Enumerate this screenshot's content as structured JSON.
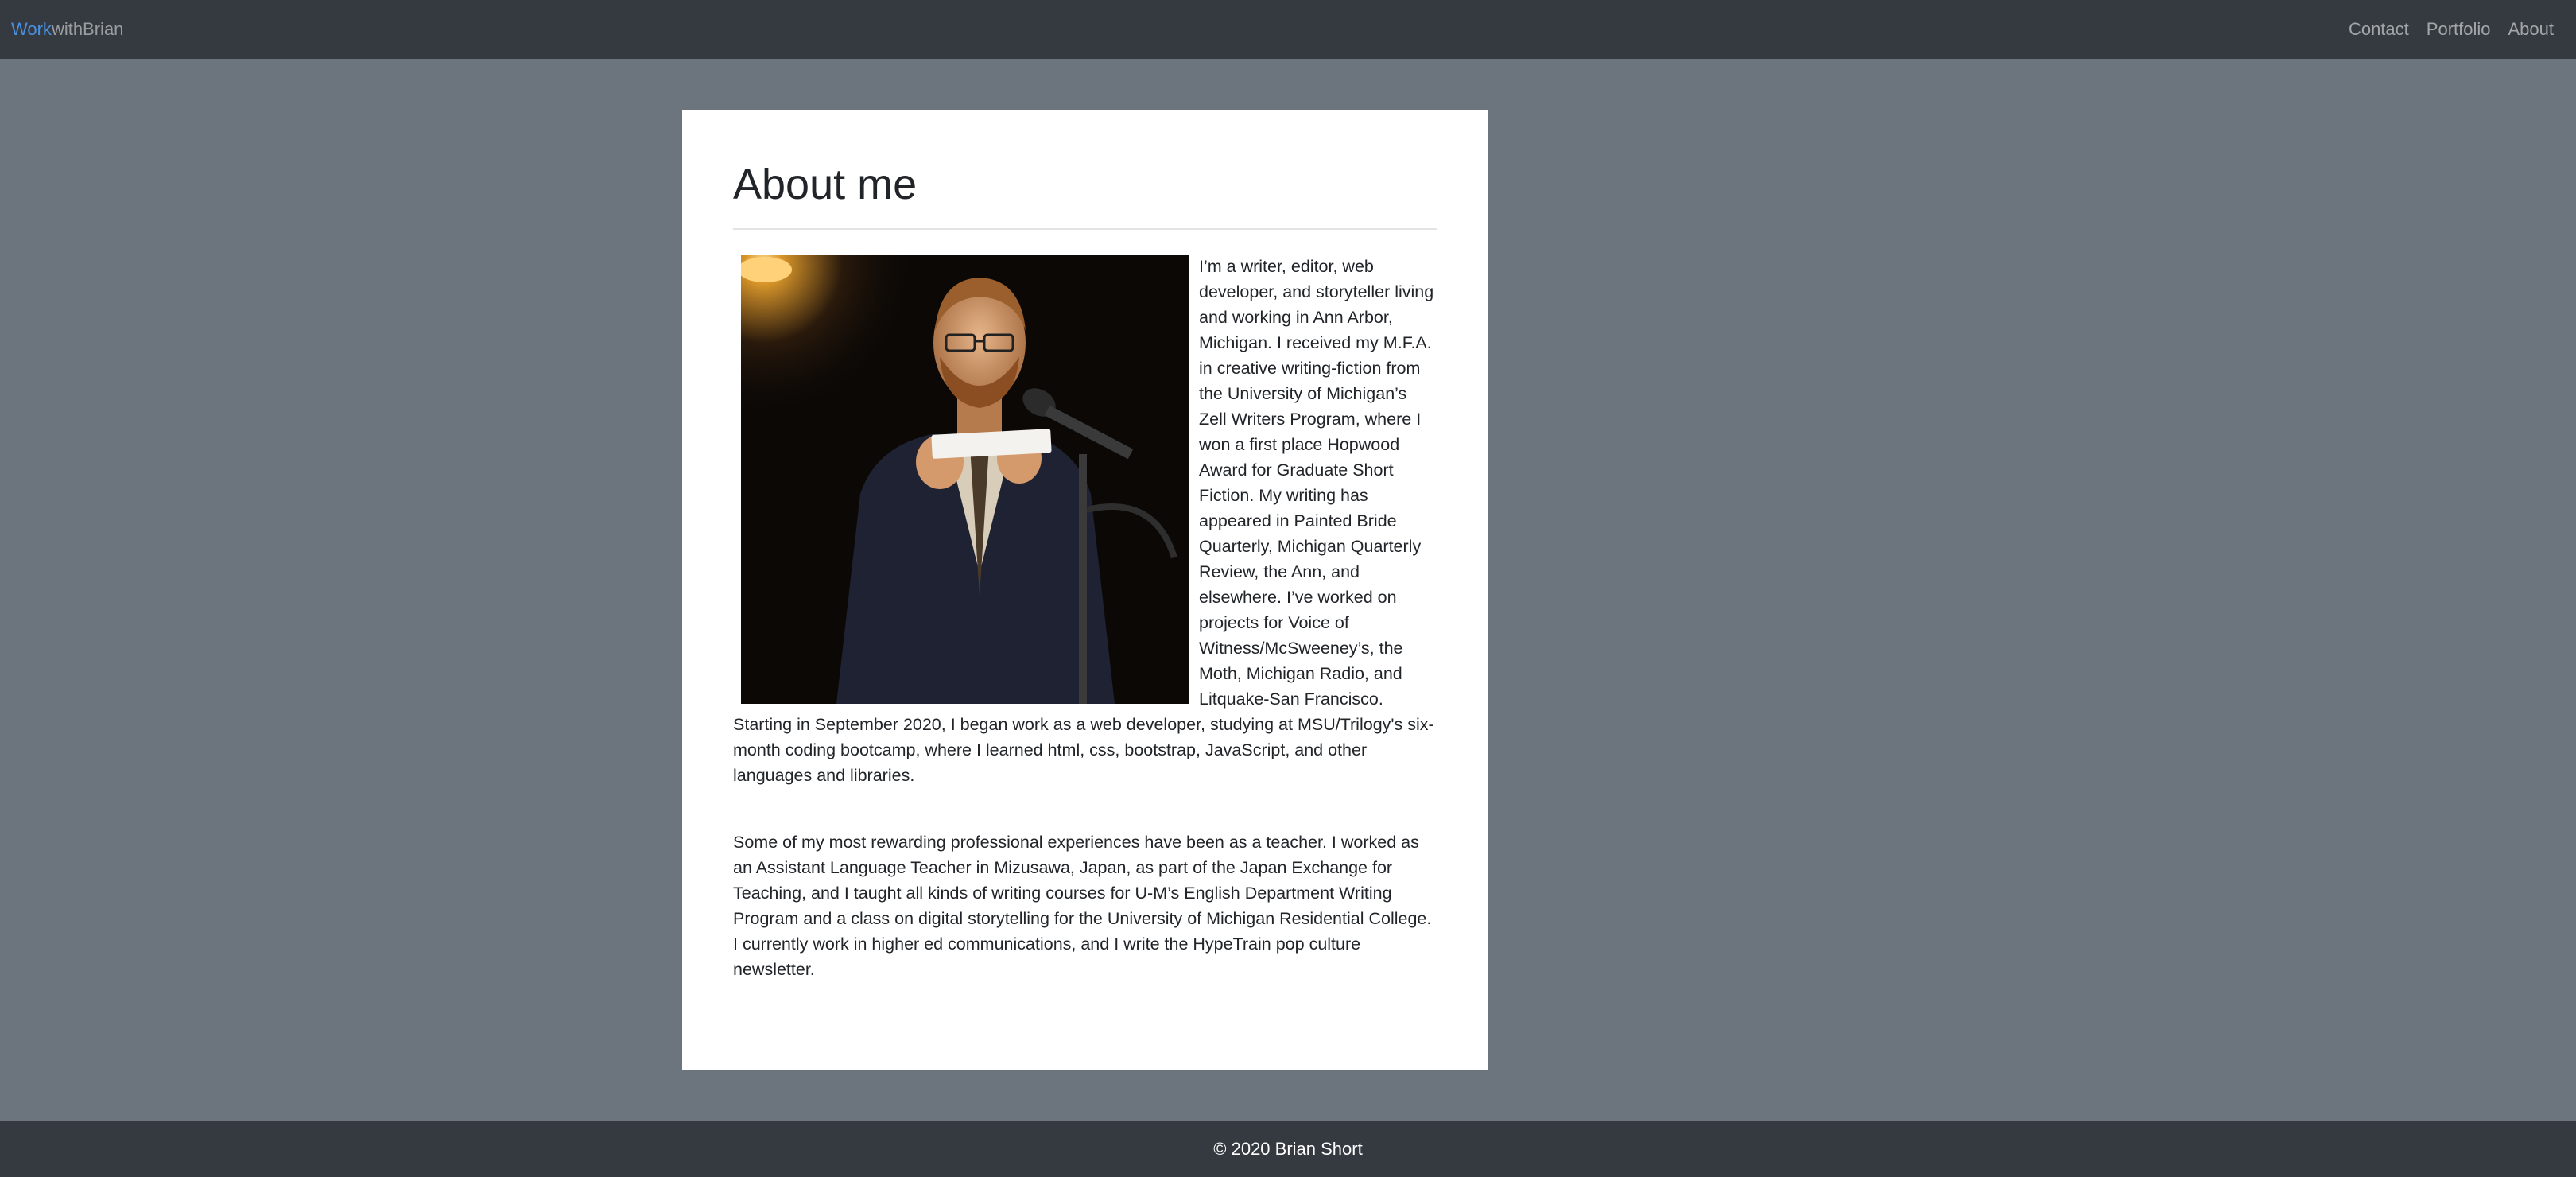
{
  "navbar": {
    "brand_accent": "Work",
    "brand_rest": "withBrian",
    "links": [
      {
        "label": "Contact"
      },
      {
        "label": "Portfolio"
      },
      {
        "label": "About"
      }
    ]
  },
  "main": {
    "title": "About me",
    "paragraphs": [
      "I’m a writer, editor, web developer, and storyteller living and working in Ann Arbor, Michigan. I received my M.F.A. in creative writing-fiction from the University of Michigan’s Zell Writers Program, where I won a first place Hopwood Award for Graduate Short Fiction. My writing has appeared in Painted Bride Quarterly, Michigan Quarterly Review, the Ann, and elsewhere. I’ve worked on projects for Voice of Witness/McSweeney’s, the Moth, Michigan Radio, and Litquake-San Francisco. Starting in September 2020, I began work as a web developer, studying at MSU/Trilogy's six-month coding bootcamp, where I learned html, css, bootstrap, JavaScript, and other languages and libraries.",
      "Some of my most rewarding professional experiences have been as a teacher. I worked as an Assistant Language Teacher in Mizusawa, Japan, as part of the Japan Exchange for Teaching, and I taught all kinds of writing courses for U-M’s English Department Writing Program and a class on digital storytelling for the University of Michigan Residential College. I currently work in higher ed communications, and I write the HypeTrain pop culture newsletter."
    ]
  },
  "footer": {
    "text": "© 2020 Brian Short"
  },
  "colors": {
    "navbar_bg": "#343a40",
    "page_bg": "#6c757d",
    "brand_accent": "#4a90e2",
    "card_bg": "#ffffff"
  }
}
